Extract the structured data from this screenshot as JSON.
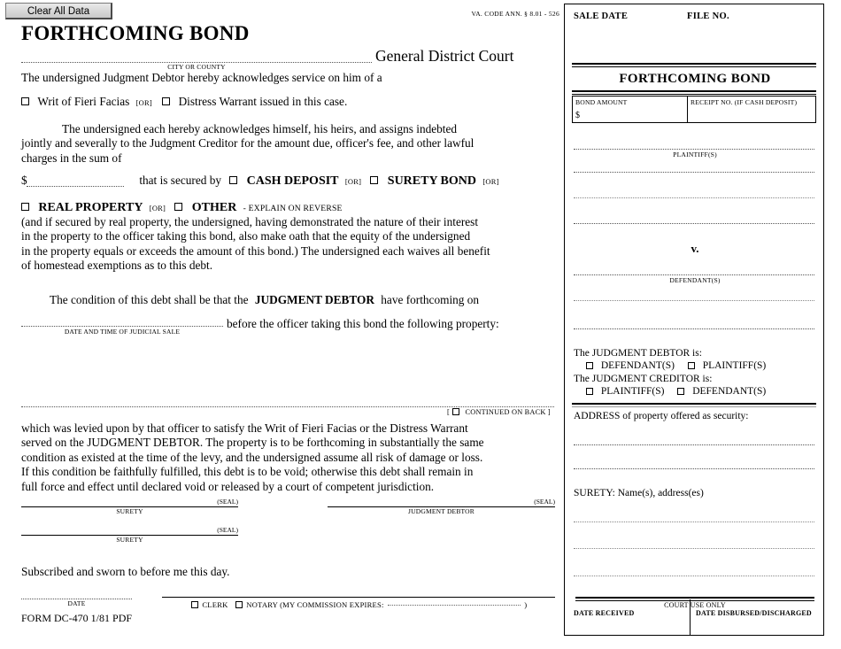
{
  "toolbar": {
    "clear_all_label": "Clear All Data"
  },
  "header": {
    "statute_ref": "VA. CODE ANN. § 8.01 - 526",
    "title": "FORTHCOMING BOND",
    "court_label": "General District Court",
    "city_or_county_caption": "CITY OR COUNTY"
  },
  "body": {
    "ack_service": "The undersigned Judgment Debtor hereby acknowledges service on him of a",
    "writ_option": "Writ of Fieri Facias",
    "or_1": "[OR]",
    "distress_option": "Distress Warrant issued in this case.",
    "indebted_p1": "The undersigned each hereby acknowledges himself, his heirs, and assigns indebted",
    "indebted_p2": "jointly and severally to the Judgment Creditor for the amount due, officer's fee, and other lawful",
    "indebted_p3": "charges in the sum of",
    "dollar_sign": "$",
    "secured_by": "that is secured by",
    "cash_deposit": "CASH DEPOSIT",
    "or_2": "[OR]",
    "surety_bond": "SURETY BOND",
    "or_3": "[OR]",
    "real_property": "REAL PROPERTY",
    "or_4": "[OR]",
    "other": "OTHER",
    "explain_on_reverse": "- EXPLAIN ON REVERSE",
    "realprop_p1": "(and if secured by real property, the undersigned, having demonstrated the nature of their interest",
    "realprop_p2": "in the property to the officer taking this bond, also make oath that the equity of the undersigned",
    "realprop_p3": "in the property equals or exceeds the amount of this bond.) The undersigned each waives all benefit",
    "realprop_p4": "of homestead exemptions as to this debt.",
    "condition_pre": "The condition of this debt shall be that the",
    "condition_bold": "JUDGMENT DEBTOR",
    "condition_post": "have forthcoming on",
    "date_sale_caption": "DATE AND TIME OF JUDICIAL SALE",
    "before_officer": "before the officer taking this bond the following property:",
    "continued_open": "[",
    "continued_on_back": "CONTINUED ON BACK ]",
    "levied_p1": "which was levied upon by that officer to satisfy the Writ of Fieri Facias or the Distress Warrant",
    "levied_p2": "served on the JUDGMENT DEBTOR. The property is to be forthcoming in substantially the same",
    "levied_p3": "condition as existed at the time of the levy, and the undersigned assume all risk of damage or loss.",
    "levied_p4": "If this condition be faithfully fulfilled, this debt is to be void; otherwise this debt shall remain in",
    "levied_p5": "full force and effect until declared void or released by a court of competent jurisdiction."
  },
  "signatures": {
    "seal": "(SEAL)",
    "surety_caption": "SURETY",
    "judgment_debtor_caption": "JUDGMENT DEBTOR",
    "surety_caption_2": "SURETY",
    "sworn_statement": "Subscribed and sworn to before me this day.",
    "date_caption": "DATE",
    "form_number": "FORM DC-470 1/81 PDF",
    "clerk_label": "CLERK",
    "notary_label": "NOTARY (MY COMMISSION EXPIRES:",
    "notary_close": ")"
  },
  "right_panel": {
    "sale_date_label": "SALE DATE",
    "file_no_label": "FILE NO.",
    "bond_title": "FORTHCOMING BOND",
    "bond_amount_label": "BOND AMOUNT",
    "bond_amount_value": "$",
    "receipt_no_label": "RECEIPT NO. (IF CASH DEPOSIT)",
    "plaintiff_caption": "PLAINTIFF(S)",
    "versus": "v.",
    "defendant_caption": "DEFENDANT(S)",
    "judgment_debtor_is": "The JUDGMENT DEBTOR is:",
    "debtor_opt_1": "DEFENDANT(S)",
    "debtor_opt_2": "PLAINTIFF(S)",
    "judgment_creditor_is": "The JUDGMENT CREDITOR is:",
    "creditor_opt_1": "PLAINTIFF(S)",
    "creditor_opt_2": "DEFENDANT(S)",
    "address_label": "ADDRESS of property offered as security:",
    "surety_label": "SURETY: Name(s), address(es)",
    "court_use_only": "COURT USE ONLY",
    "date_received_label": "DATE RECEIVED",
    "date_disbursed_label": "DATE DISBURSED/DISCHARGED"
  }
}
